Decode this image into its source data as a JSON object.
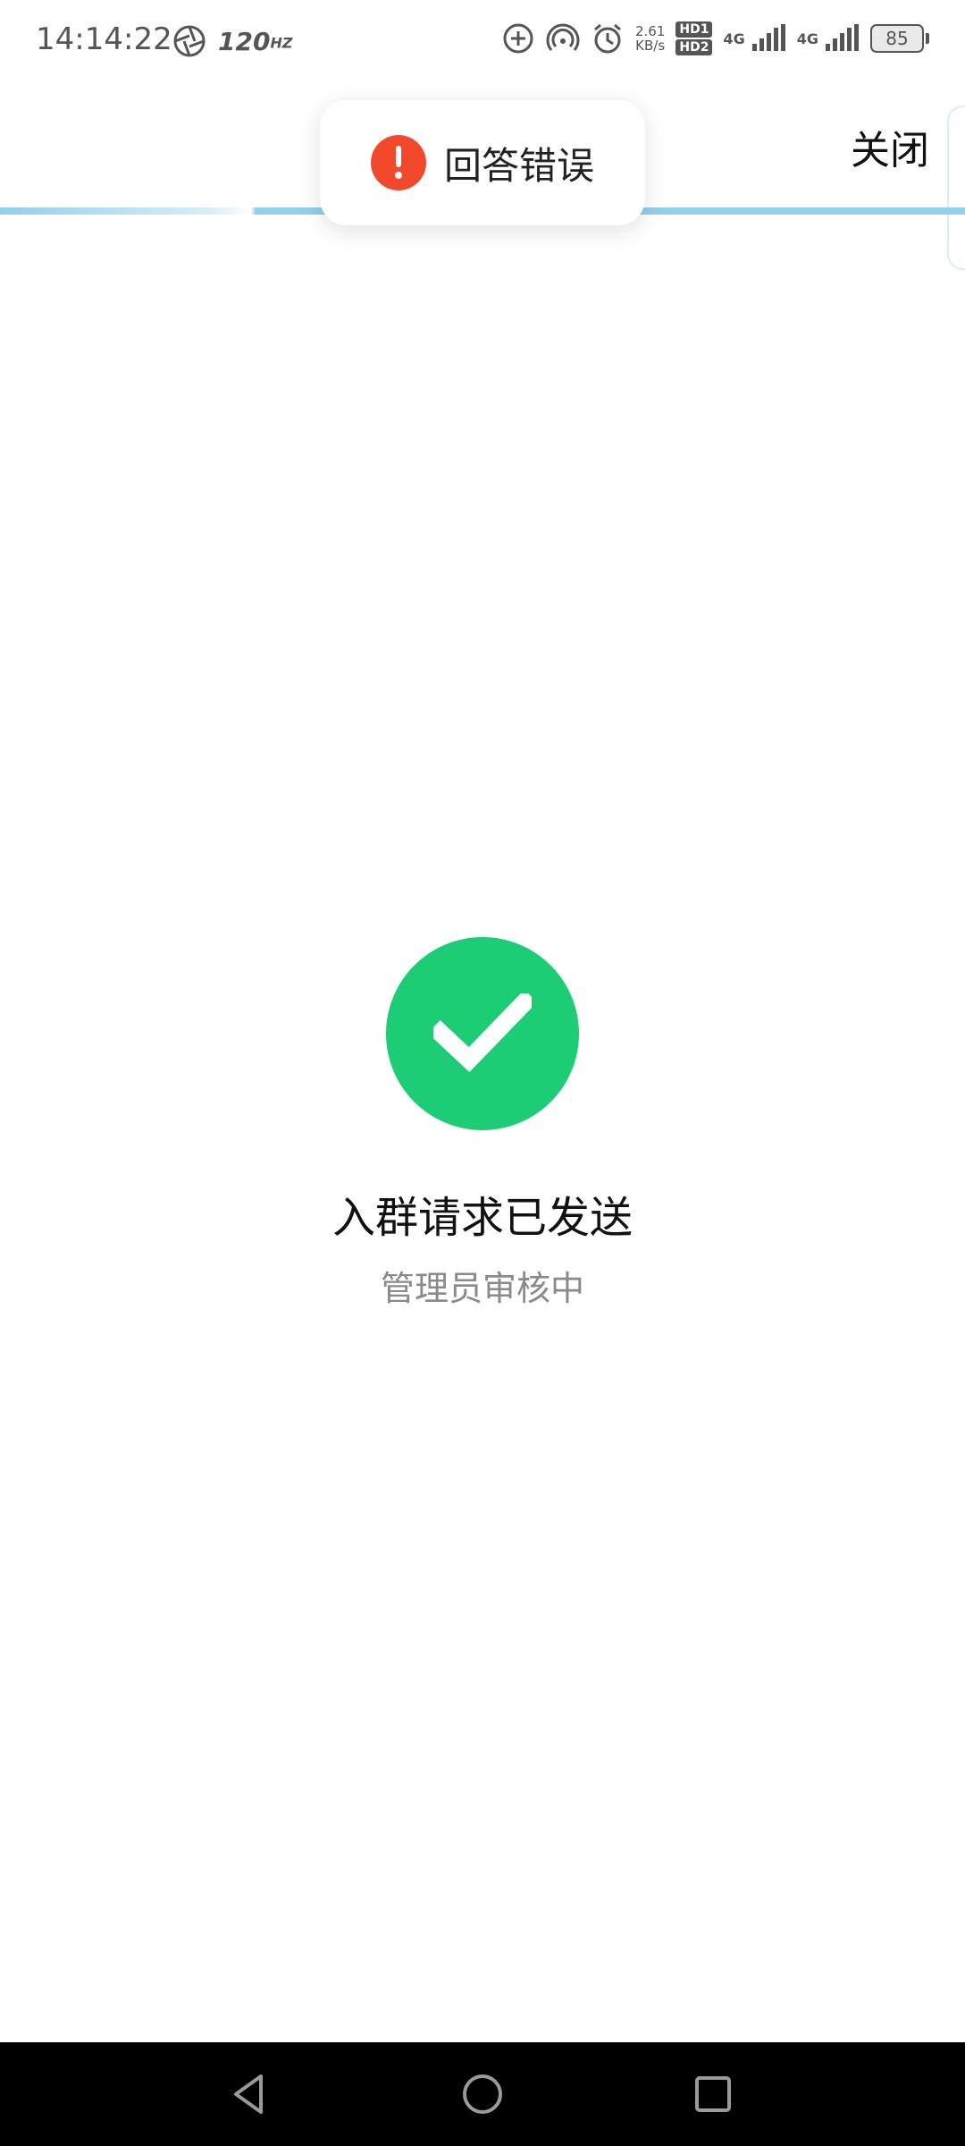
{
  "status_bar": {
    "time": "14:14:22",
    "refresh_rate": "120",
    "net_speed_value": "2.61",
    "net_speed_unit": "KB/s",
    "hd_top": "HD1",
    "hd_bottom": "HD2",
    "sim1_label": "4G",
    "sim2_label": "4G",
    "battery": "85"
  },
  "header": {
    "close_label": "关闭"
  },
  "toast": {
    "message": "回答错误",
    "icon": "error-exclamation-icon",
    "color": "#f2492d"
  },
  "main": {
    "title": "入群请求已发送",
    "subtitle": "管理员审核中",
    "icon": "check-circle-icon",
    "accent_color": "#1ccd75"
  },
  "nav_bar": {
    "back_icon": "back-triangle-icon",
    "home_icon": "home-circle-icon",
    "recent_icon": "recent-square-icon"
  }
}
